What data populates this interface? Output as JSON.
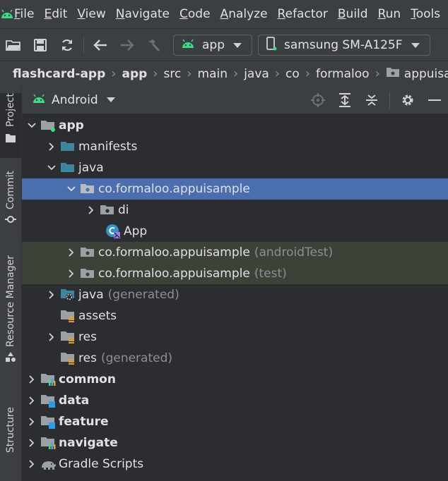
{
  "menu": {
    "items": [
      "File",
      "Edit",
      "View",
      "Navigate",
      "Code",
      "Analyze",
      "Refactor",
      "Build",
      "Run",
      "Tools"
    ]
  },
  "toolbar": {
    "run_config": "app",
    "device": "samsung SM-A125F"
  },
  "breadcrumb": [
    "flashcard-app",
    "app",
    "src",
    "main",
    "java",
    "co",
    "formaloo",
    "appuisample"
  ],
  "side_tabs": {
    "project": "Project",
    "commit": "Commit",
    "resource_manager": "Resource Manager",
    "structure": "Structure"
  },
  "panel": {
    "view": "Android"
  },
  "tree": [
    {
      "name": "app",
      "suffix": "",
      "bold": true,
      "expanded": true
    },
    {
      "name": "manifests",
      "suffix": "",
      "bold": false,
      "expanded": false
    },
    {
      "name": "java",
      "suffix": "",
      "bold": false,
      "expanded": true
    },
    {
      "name": "co.formaloo.appuisample",
      "suffix": "",
      "bold": false,
      "expanded": true,
      "selected": true
    },
    {
      "name": "di",
      "suffix": "",
      "bold": false,
      "expanded": false
    },
    {
      "name": "App",
      "suffix": "",
      "bold": false
    },
    {
      "name": "co.formaloo.appuisample",
      "suffix": "(androidTest)",
      "bold": false,
      "expanded": false
    },
    {
      "name": "co.formaloo.appuisample",
      "suffix": "(test)",
      "bold": false,
      "expanded": false
    },
    {
      "name": "java",
      "suffix": "(generated)",
      "bold": false,
      "expanded": false
    },
    {
      "name": "assets",
      "suffix": "",
      "bold": false
    },
    {
      "name": "res",
      "suffix": "",
      "bold": false,
      "expanded": false
    },
    {
      "name": "res",
      "suffix": "(generated)",
      "bold": false
    },
    {
      "name": "common",
      "suffix": "",
      "bold": true,
      "expanded": false
    },
    {
      "name": "data",
      "suffix": "",
      "bold": true,
      "expanded": false
    },
    {
      "name": "feature",
      "suffix": "",
      "bold": true,
      "expanded": false
    },
    {
      "name": "navigate",
      "suffix": "",
      "bold": true,
      "expanded": false
    },
    {
      "name": "Gradle Scripts",
      "suffix": "",
      "bold": false,
      "expanded": false
    }
  ],
  "colors": {
    "background": "#2b2d30",
    "chrome": "#3c3f41",
    "selection": "#4b6eaf",
    "test_highlight": "#3c4237",
    "android_green": "#3ddc84",
    "folder_blue": "#3e86a0"
  }
}
